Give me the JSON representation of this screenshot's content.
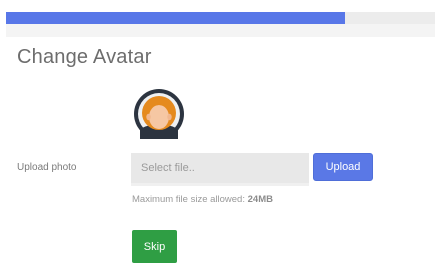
{
  "progress": {
    "value_percent": 79,
    "fill_color": "#5877e8"
  },
  "page": {
    "title": "Change Avatar"
  },
  "avatar": {
    "icon": "user-avatar-icon",
    "ring_color": "#2c3440",
    "face_color": "#f6c7a3",
    "hair_color": "#e58a1e"
  },
  "upload": {
    "label": "Upload photo",
    "file_placeholder": "Select file..",
    "button_label": "Upload",
    "note_prefix": "Maximum file size allowed: ",
    "note_limit": "24MB"
  },
  "actions": {
    "skip_label": "Skip",
    "skip_color": "#2f9e44"
  }
}
